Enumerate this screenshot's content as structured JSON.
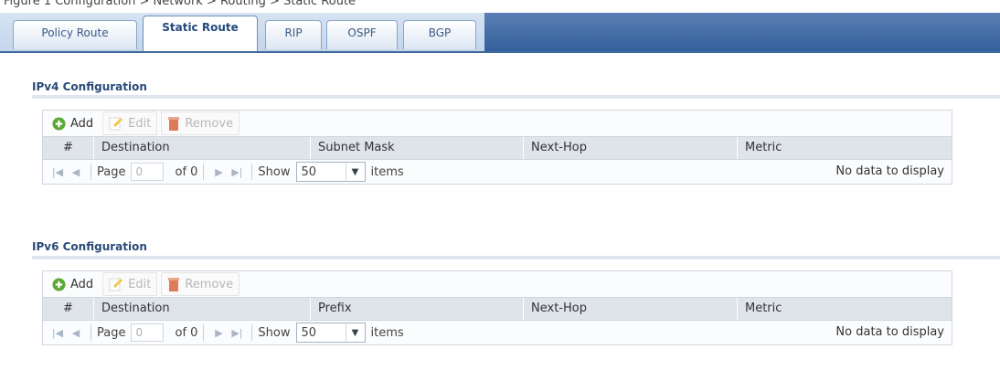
{
  "caption": "Figure 1 Configuration > Network > Routing > Static Route",
  "tabs": [
    {
      "label": "Policy Route",
      "active": false
    },
    {
      "label": "Static Route",
      "active": true
    },
    {
      "label": "RIP",
      "active": false
    },
    {
      "label": "OSPF",
      "active": false
    },
    {
      "label": "BGP",
      "active": false
    }
  ],
  "ipv4": {
    "title": "IPv4 Configuration",
    "toolbar": {
      "add": "Add",
      "edit": "Edit",
      "remove": "Remove"
    },
    "columns": [
      "#",
      "Destination",
      "Subnet Mask",
      "Next-Hop",
      "Metric"
    ],
    "pager": {
      "page_label": "Page",
      "page_value": "0",
      "of_label": "of 0",
      "show_label": "Show",
      "show_value": "50",
      "items_label": "items",
      "status": "No data to display"
    }
  },
  "ipv6": {
    "title": "IPv6 Configuration",
    "toolbar": {
      "add": "Add",
      "edit": "Edit",
      "remove": "Remove"
    },
    "columns": [
      "#",
      "Destination",
      "Prefix",
      "Next-Hop",
      "Metric"
    ],
    "pager": {
      "page_label": "Page",
      "page_value": "0",
      "of_label": "of 0",
      "show_label": "Show",
      "show_value": "50",
      "items_label": "items",
      "status": "No data to display"
    }
  },
  "colors": {
    "tab_active_text": "#234a7d",
    "header_bg": "#dfe3ea",
    "add_icon": "#5aa832",
    "remove_icon": "#e07b5a"
  }
}
